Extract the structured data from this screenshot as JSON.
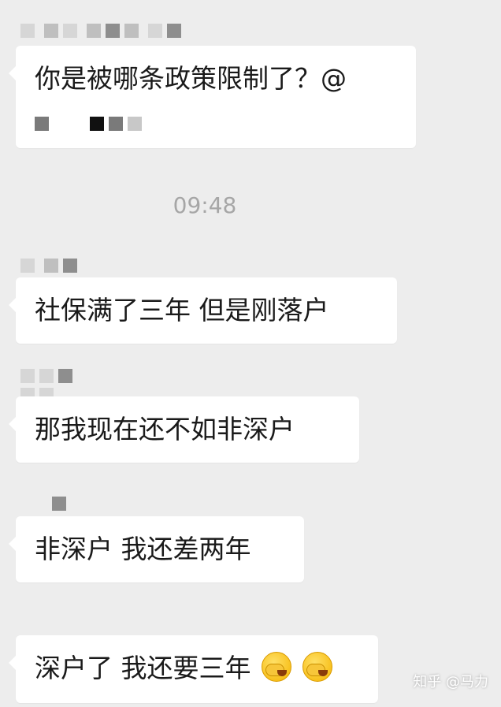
{
  "chat": {
    "messages": [
      {
        "text": "你是被哪条政策限制了？@"
      },
      {
        "text": "社保满了三年 但是刚落户"
      },
      {
        "text": "那我现在还不如非深户"
      },
      {
        "text": "非深户 我还差两年"
      },
      {
        "text": "深户了 我还要三年"
      }
    ],
    "timestamp": "09:48",
    "emoji_name": "facepalm-emoji"
  },
  "watermark": "知乎 @马力"
}
